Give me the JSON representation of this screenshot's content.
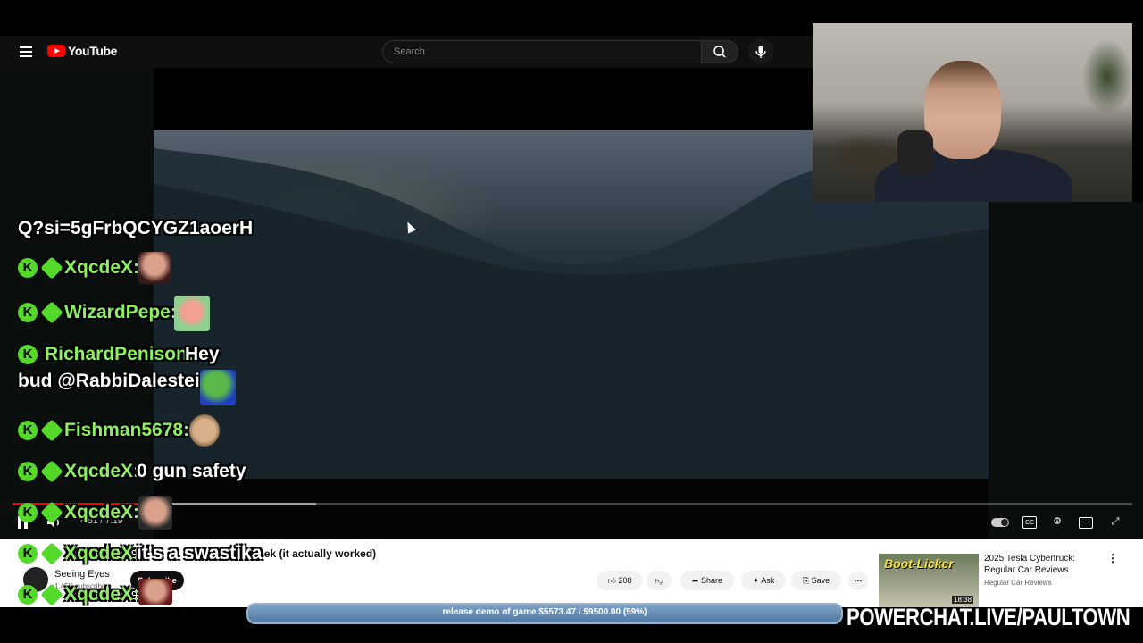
{
  "header": {
    "logo_text": "YouTube",
    "search_placeholder": "Search"
  },
  "player": {
    "time": "4:51 / 7:19",
    "progress_played_fraction": 0.11,
    "progress_buffered_fraction": 0.27
  },
  "chat": {
    "partial_line": "Q?si=5gFrbQCYGZ1aoerH",
    "messages": [
      {
        "user": "XqcdeX:",
        "text": ""
      },
      {
        "user": "WizardPepe:",
        "text": ""
      },
      {
        "user": "RichardPenison:",
        "text": "Hey",
        "continued": "bud @RabbiDalestein"
      },
      {
        "user": "Fishman5678:",
        "text": ""
      },
      {
        "user": "XqcdeX:",
        "text": "0 gun safety"
      },
      {
        "user": "XqcdeX:",
        "text": ""
      },
      {
        "user": "XqcdeX:",
        "text": "it's a swastika"
      },
      {
        "user": "XqcdeX:",
        "text": ""
      }
    ]
  },
  "video": {
    "title": "Week (it actually worked)",
    "channel_name": "Seeing Eyes",
    "subscribers": "1.45K subscribers",
    "subscribe_label": "Subscribe",
    "like_count": "208",
    "share_label": "Share",
    "ask_label": "Ask",
    "save_label": "Save"
  },
  "recommendation": {
    "thumb_label": "Boot-Licker",
    "title": "2025 Tesla Cybertruck: Regular Car Reviews",
    "channel": "Regular Car Reviews",
    "duration": "18:38"
  },
  "overlay": {
    "goal_text": "release demo of game $5573.47 / $9500.00 (59%)",
    "goal_fraction": 0.59,
    "brand": "POWERCHAT.LIVE/PAULTOWN"
  },
  "colors": {
    "chat_user": "#8cf060",
    "badge": "#54d82a",
    "progress_played": "#ff0000",
    "youtube_red": "#ff0000"
  },
  "icons": [
    "menu-icon",
    "youtube-logo-icon",
    "search-icon",
    "mic-icon",
    "pause-icon",
    "volume-icon",
    "autoplay-toggle-icon",
    "cc-icon",
    "settings-gear-icon",
    "theater-icon",
    "fullscreen-icon",
    "like-icon",
    "dislike-icon",
    "share-icon",
    "ask-sparkle-icon",
    "save-bookmark-icon",
    "more-dots-icon"
  ]
}
